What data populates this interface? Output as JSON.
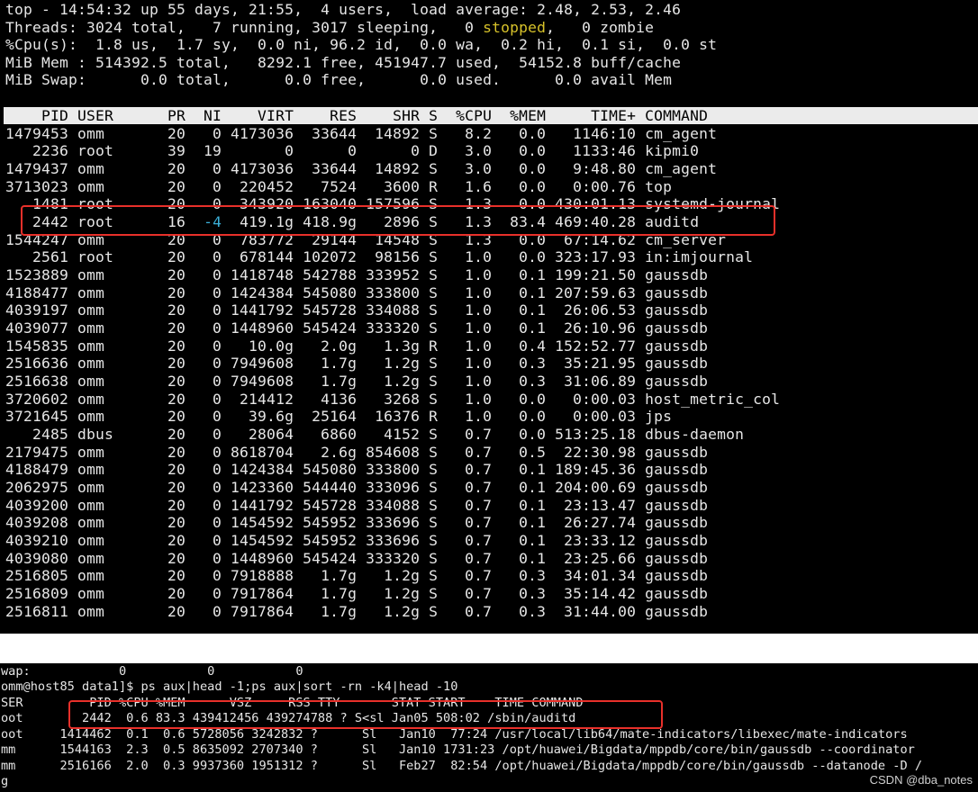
{
  "top_summary": {
    "line1": "top - 14:54:32 up 55 days, 21:55,  4 users,  load average: 2.48, 2.53, 2.46",
    "line2_before": "Threads: 3024 total,   7 running, 3017 sleeping,   0 ",
    "line2_stopped": "stopped",
    "line2_after": ",   0 zombie",
    "line3": "%Cpu(s):  1.8 us,  1.7 sy,  0.0 ni, 96.2 id,  0.0 wa,  0.2 hi,  0.1 si,  0.0 st",
    "line4": "MiB Mem : 514392.5 total,   8292.1 free, 451947.7 used,  54152.8 buff/cache",
    "line5": "MiB Swap:      0.0 total,      0.0 free,      0.0 used.      0.0 avail Mem"
  },
  "top_header": "    PID USER      PR  NI    VIRT    RES    SHR S  %CPU  %MEM     TIME+ COMMAND",
  "top_rows": [
    "1479453 omm       20   0 4173036  33644  14892 S   8.2   0.0   1146:10 cm_agent",
    "   2236 root      39  19       0      0      0 D   3.0   0.0   1133:46 kipmi0",
    "1479437 omm       20   0 4173036  33644  14892 S   3.0   0.0   9:48.80 cm_agent",
    "3713023 omm       20   0  220452   7524   3600 R   1.6   0.0   0:00.76 top",
    "   1481 root      20   0  343920 163040 157596 S   1.3   0.0 430:01.13 systemd-journal",
    "   2442 root      16  -4  419.1g 418.9g   2896 S   1.3  83.4 469:40.28 auditd",
    "1544247 omm       20   0  783772  29144  14548 S   1.3   0.0  67:14.62 cm_server",
    "   2561 root      20   0  678144 102072  98156 S   1.0   0.0 323:17.93 in:imjournal",
    "1523889 omm       20   0 1418748 542788 333952 S   1.0   0.1 199:21.50 gaussdb",
    "4188477 omm       20   0 1424384 545080 333800 S   1.0   0.1 207:59.63 gaussdb",
    "4039197 omm       20   0 1441792 545728 334088 S   1.0   0.1  26:06.53 gaussdb",
    "4039077 omm       20   0 1448960 545424 333320 S   1.0   0.1  26:10.96 gaussdb",
    "1545835 omm       20   0   10.0g   2.0g   1.3g R   1.0   0.4 152:52.77 gaussdb",
    "2516636 omm       20   0 7949608   1.7g   1.2g S   1.0   0.3  35:21.95 gaussdb",
    "2516638 omm       20   0 7949608   1.7g   1.2g S   1.0   0.3  31:06.89 gaussdb",
    "3720602 omm       20   0  214412   4136   3268 S   1.0   0.0   0:00.03 host_metric_col",
    "3721645 omm       20   0   39.6g  25164  16376 R   1.0   0.0   0:00.03 jps",
    "   2485 dbus      20   0   28064   6860   4152 S   0.7   0.0 513:25.18 dbus-daemon",
    "2179475 omm       20   0 8618704   2.6g 854608 S   0.7   0.5  22:30.98 gaussdb",
    "4188479 omm       20   0 1424384 545080 333800 S   0.7   0.1 189:45.36 gaussdb",
    "2062975 omm       20   0 1423360 544440 333096 S   0.7   0.1 204:00.69 gaussdb",
    "4039200 omm       20   0 1441792 545728 334088 S   0.7   0.1  23:13.47 gaussdb",
    "4039208 omm       20   0 1454592 545952 333696 S   0.7   0.1  26:27.74 gaussdb",
    "4039210 omm       20   0 1454592 545952 333696 S   0.7   0.1  23:33.12 gaussdb",
    "4039080 omm       20   0 1448960 545424 333320 S   0.7   0.1  23:25.66 gaussdb",
    "2516805 omm       20   0 7918888   1.7g   1.2g S   0.7   0.3  34:01.34 gaussdb",
    "2516809 omm       20   0 7917864   1.7g   1.2g S   0.7   0.3  35:14.42 gaussdb",
    "2516811 omm       20   0 7917864   1.7g   1.2g S   0.7   0.3  31:44.00 gaussdb"
  ],
  "auditd_row": {
    "pre": "   2442 root      16  ",
    "ni": "-4",
    "post": "  419.1g 418.9g   2896 S   1.3  83.4 469:40.28 auditd"
  },
  "ps_terminal": {
    "lines": [
      "wap:            0           0           0",
      "omm@host85 data1]$ ps aux|head -1;ps aux|sort -rn -k4|head -10",
      "SER         PID %CPU %MEM      VSZ     RSS TTY       STAT START    TIME COMMAND",
      "oot        2442  0.6 83.3 439412456 439274788 ? S<sl Jan05 508:02 /sbin/auditd",
      "oot     1414462  0.1  0.6 5728056 3242832 ?      Sl   Jan10  77:24 /usr/local/lib64/mate-indicators/libexec/mate-indicators",
      "mm      1544163  2.3  0.5 8635092 2707340 ?      Sl   Jan10 1731:23 /opt/huawei/Bigdata/mppdb/core/bin/gaussdb --coordinator",
      "mm      2516166  2.0  0.3 9937360 1951312 ?      Sl   Feb27  82:54 /opt/huawei/Bigdata/mppdb/core/bin/gaussdb --datanode -D /",
      "g"
    ],
    "watermark": "CSDN @dba_notes"
  },
  "colors": {
    "terminal_bg": "#000000",
    "terminal_fg": "#e6e6e6",
    "header_bar": "#ebebeb",
    "stopped": "#d7c22a",
    "ni_negative": "#3bb0d8",
    "highlight_box": "#e8302a"
  }
}
